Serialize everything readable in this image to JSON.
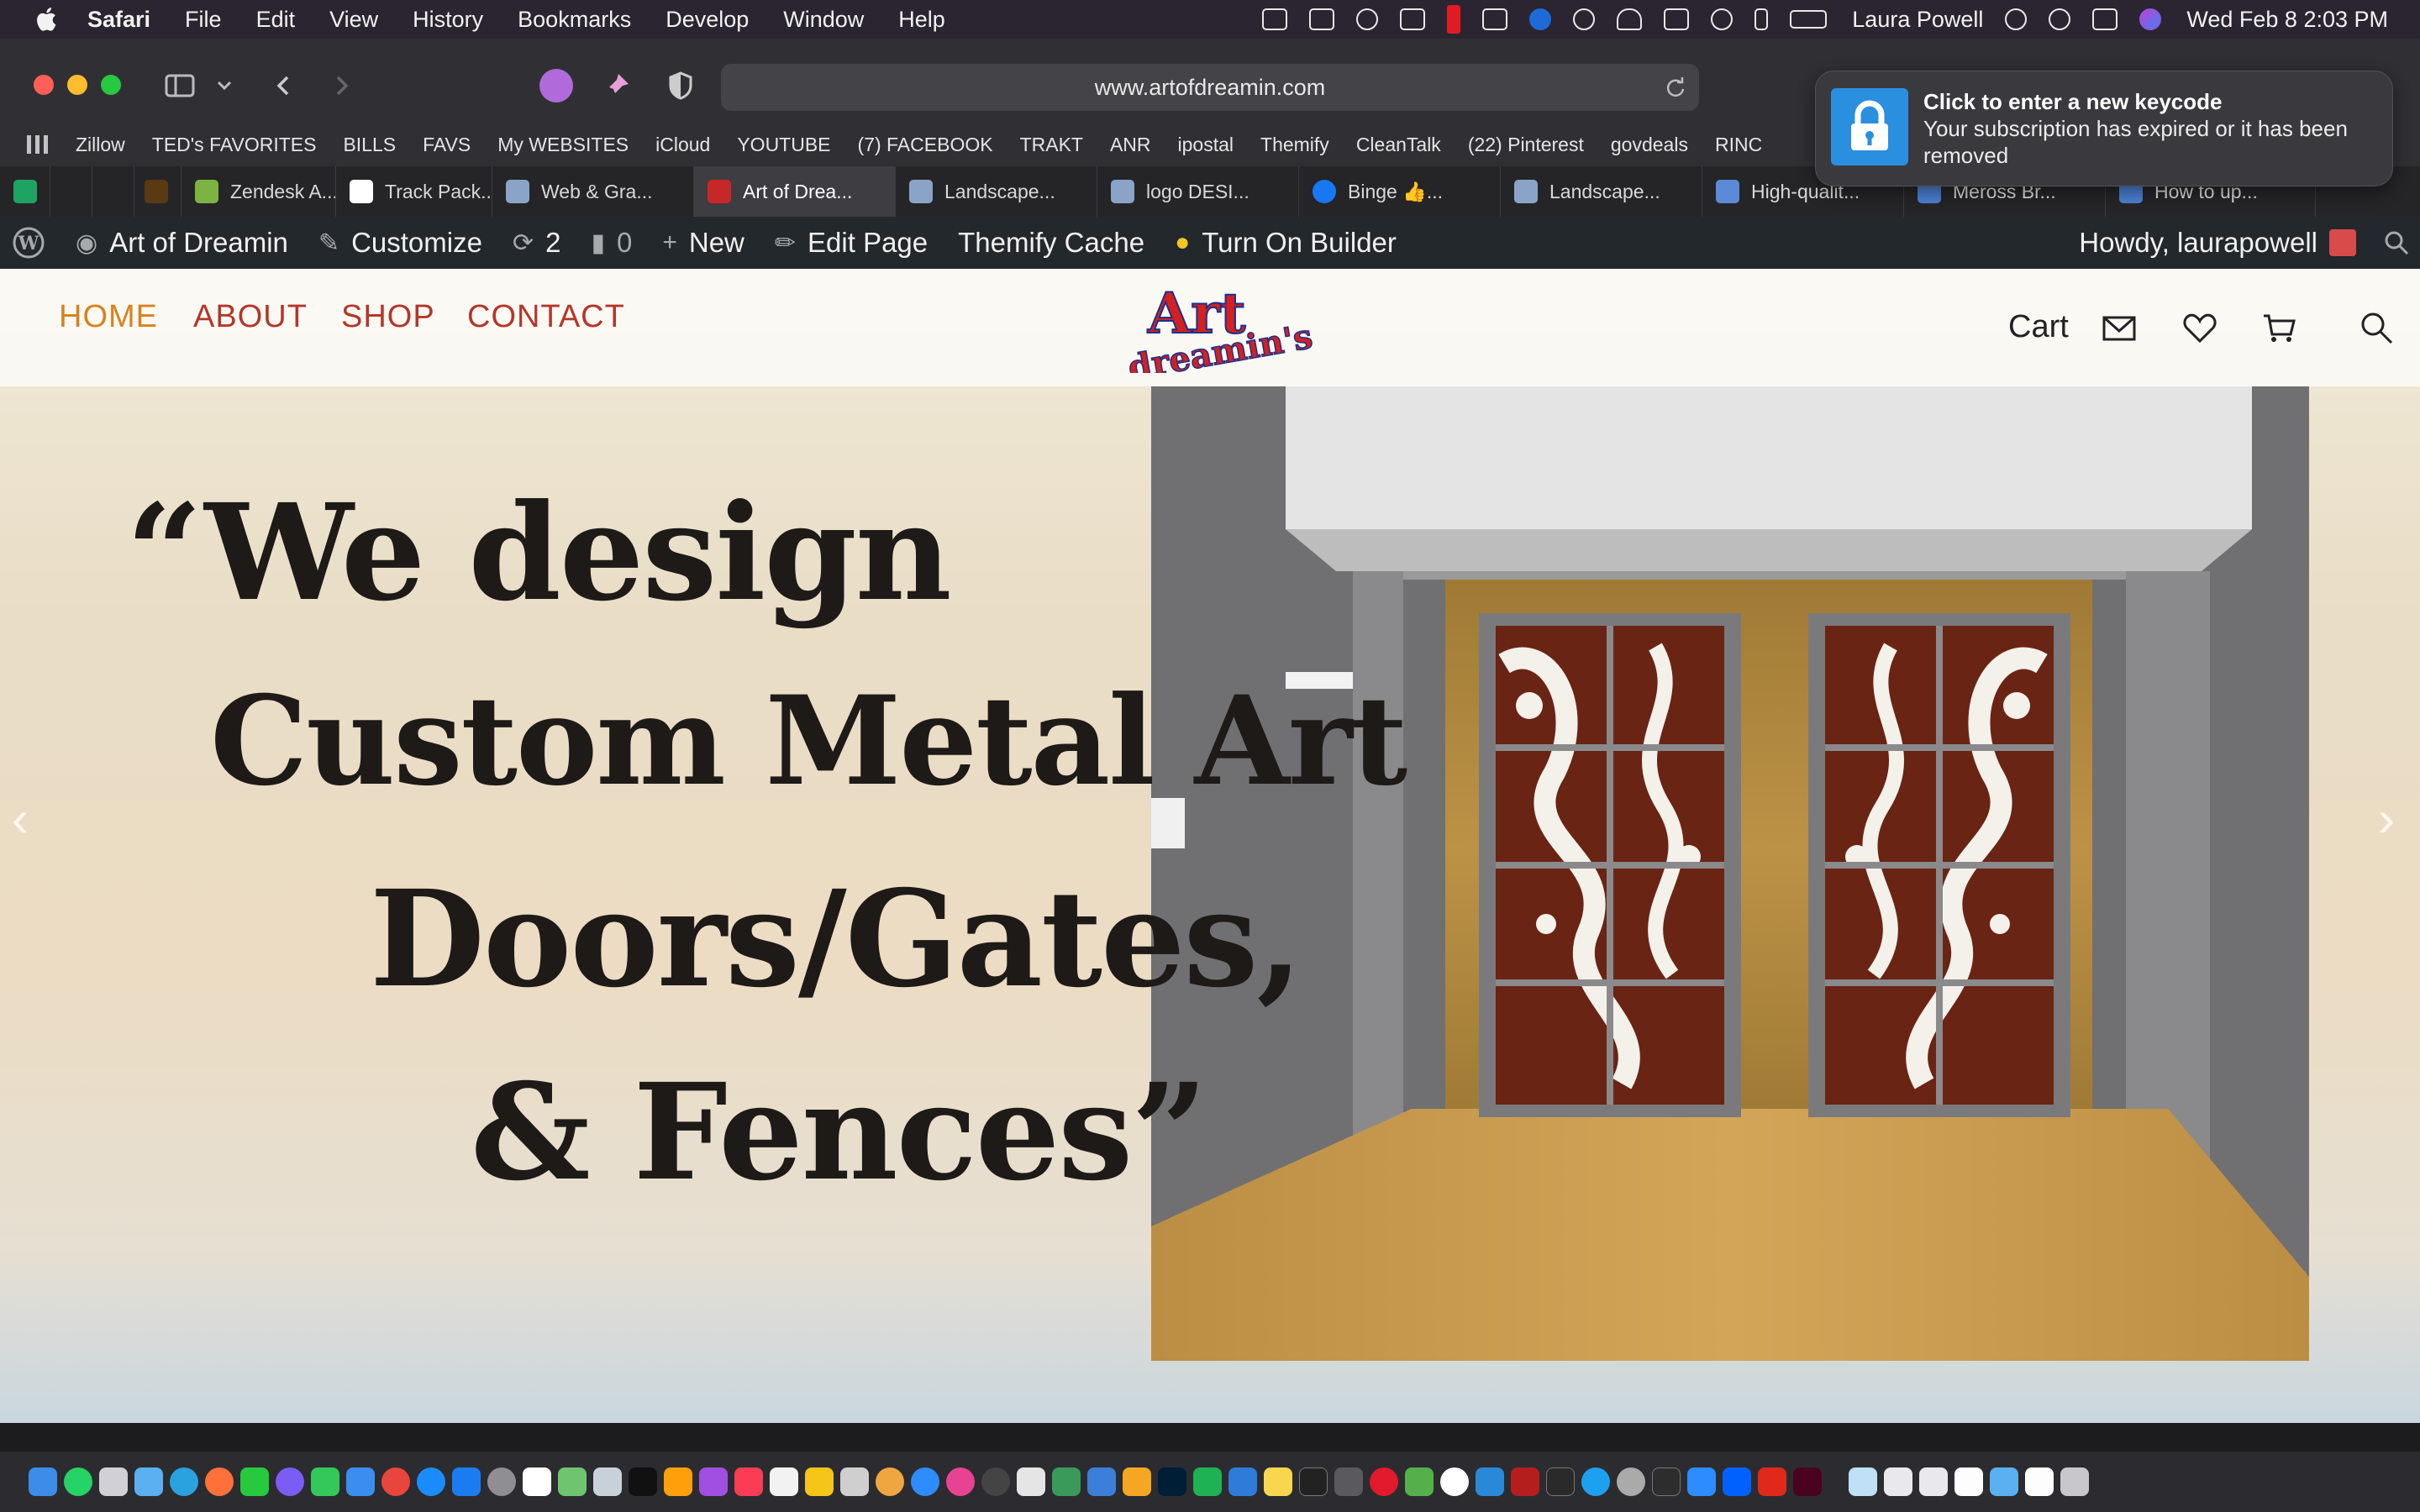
{
  "menubar": {
    "items": [
      "Safari",
      "File",
      "Edit",
      "View",
      "History",
      "Bookmarks",
      "Develop",
      "Window",
      "Help"
    ],
    "user": "Laura Powell",
    "datetime": "Wed Feb 8  2:03 PM"
  },
  "toolbar": {
    "url": "www.artofdreamin.com"
  },
  "bookmarks": [
    "Zillow",
    "TED's FAVORITES",
    "BILLS",
    "FAVS",
    "My WEBSITES",
    "iCloud",
    "YOUTUBE",
    "(7) FACEBOOK",
    "TRAKT",
    "ANR",
    "ipostal",
    "Themify",
    "CleanTalk",
    "(22) Pinterest",
    "govdeals",
    "RINC"
  ],
  "tabs": [
    {
      "label": "Zendesk A...",
      "color": "#7cb342"
    },
    {
      "label": "Track Pack...",
      "color": "#ffffff"
    },
    {
      "label": "Web & Gra...",
      "color": "#8aa4c8"
    },
    {
      "label": "Art of Drea...",
      "color": "#c62828"
    },
    {
      "label": "Landscape...",
      "color": "#8aa4c8"
    },
    {
      "label": "logo DESI...",
      "color": "#8aa4c8"
    },
    {
      "label": "Binge 👍...",
      "color": "#1877f2"
    },
    {
      "label": "Landscape...",
      "color": "#8aa4c8"
    },
    {
      "label": "High-qualit...",
      "color": "#5b8bd6"
    },
    {
      "label": "Meross Br...",
      "color": "#4a7fd0"
    },
    {
      "label": "How to up...",
      "color": "#4a7fd0"
    }
  ],
  "wpbar": {
    "site": "Art of Dreamin",
    "customize": "Customize",
    "updates": "2",
    "comments": "0",
    "new": "New",
    "edit": "Edit Page",
    "cache": "Themify Cache",
    "builder": "Turn On Builder",
    "howdy": "Howdy, laurapowell"
  },
  "site": {
    "nav": [
      {
        "label": "HOME",
        "color": "#d9821f"
      },
      {
        "label": "ABOUT",
        "color": "#b5362a"
      },
      {
        "label": "SHOP",
        "color": "#b5362a"
      },
      {
        "label": "CONTACT",
        "color": "#b5362a"
      }
    ],
    "logo_text": "Art of dreamin's",
    "cart_label": "Cart",
    "quote": [
      "“We design",
      "Custom Metal Art",
      "Doors/Gates,",
      "& Fences”"
    ]
  },
  "notification": {
    "title": "Click to enter a new keycode",
    "message": "Your subscription has expired or it has been removed"
  },
  "colors": {
    "accent_nav_active": "#d9821f",
    "accent_nav": "#b5362a",
    "wp_admin_bar": "#23282d",
    "metal_panel": "#6a2414"
  }
}
